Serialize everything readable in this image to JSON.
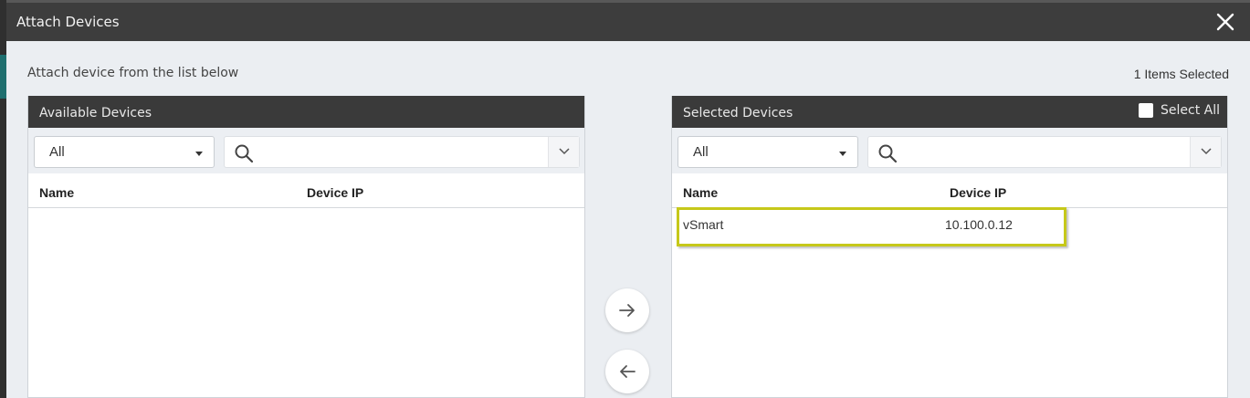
{
  "dialog": {
    "title": "Attach Devices",
    "instructions": "Attach device from the list below",
    "items_selected": "1 Items Selected"
  },
  "available": {
    "header": "Available Devices",
    "filter_value": "All",
    "columns": {
      "name": "Name",
      "ip": "Device IP"
    },
    "rows": []
  },
  "selected": {
    "header": "Selected Devices",
    "select_all_label": "Select All",
    "filter_value": "All",
    "columns": {
      "name": "Name",
      "ip": "Device IP"
    },
    "rows": [
      {
        "name": "vSmart",
        "ip": "10.100.0.12"
      }
    ]
  },
  "icons": {
    "close": "close-icon",
    "search": "search-icon",
    "chevron": "chevron-down-icon",
    "move_right": "arrow-right-icon",
    "move_left": "arrow-left-icon"
  },
  "colors": {
    "titlebar": "#3d3d3d",
    "panel_header": "#3a3a3a",
    "highlight": "#c6c81a",
    "background": "#ebeef2"
  }
}
